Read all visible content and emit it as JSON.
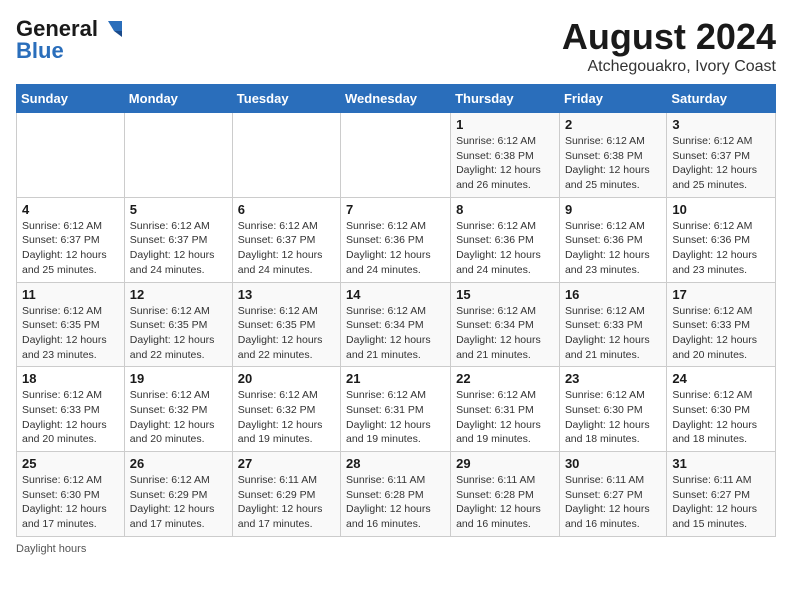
{
  "header": {
    "logo_general": "General",
    "logo_blue": "Blue",
    "month_title": "August 2024",
    "location": "Atchegouakro, Ivory Coast"
  },
  "days_of_week": [
    "Sunday",
    "Monday",
    "Tuesday",
    "Wednesday",
    "Thursday",
    "Friday",
    "Saturday"
  ],
  "weeks": [
    [
      {
        "day": "",
        "info": ""
      },
      {
        "day": "",
        "info": ""
      },
      {
        "day": "",
        "info": ""
      },
      {
        "day": "",
        "info": ""
      },
      {
        "day": "1",
        "info": "Sunrise: 6:12 AM\nSunset: 6:38 PM\nDaylight: 12 hours\nand 26 minutes."
      },
      {
        "day": "2",
        "info": "Sunrise: 6:12 AM\nSunset: 6:38 PM\nDaylight: 12 hours\nand 25 minutes."
      },
      {
        "day": "3",
        "info": "Sunrise: 6:12 AM\nSunset: 6:37 PM\nDaylight: 12 hours\nand 25 minutes."
      }
    ],
    [
      {
        "day": "4",
        "info": "Sunrise: 6:12 AM\nSunset: 6:37 PM\nDaylight: 12 hours\nand 25 minutes."
      },
      {
        "day": "5",
        "info": "Sunrise: 6:12 AM\nSunset: 6:37 PM\nDaylight: 12 hours\nand 24 minutes."
      },
      {
        "day": "6",
        "info": "Sunrise: 6:12 AM\nSunset: 6:37 PM\nDaylight: 12 hours\nand 24 minutes."
      },
      {
        "day": "7",
        "info": "Sunrise: 6:12 AM\nSunset: 6:36 PM\nDaylight: 12 hours\nand 24 minutes."
      },
      {
        "day": "8",
        "info": "Sunrise: 6:12 AM\nSunset: 6:36 PM\nDaylight: 12 hours\nand 24 minutes."
      },
      {
        "day": "9",
        "info": "Sunrise: 6:12 AM\nSunset: 6:36 PM\nDaylight: 12 hours\nand 23 minutes."
      },
      {
        "day": "10",
        "info": "Sunrise: 6:12 AM\nSunset: 6:36 PM\nDaylight: 12 hours\nand 23 minutes."
      }
    ],
    [
      {
        "day": "11",
        "info": "Sunrise: 6:12 AM\nSunset: 6:35 PM\nDaylight: 12 hours\nand 23 minutes."
      },
      {
        "day": "12",
        "info": "Sunrise: 6:12 AM\nSunset: 6:35 PM\nDaylight: 12 hours\nand 22 minutes."
      },
      {
        "day": "13",
        "info": "Sunrise: 6:12 AM\nSunset: 6:35 PM\nDaylight: 12 hours\nand 22 minutes."
      },
      {
        "day": "14",
        "info": "Sunrise: 6:12 AM\nSunset: 6:34 PM\nDaylight: 12 hours\nand 21 minutes."
      },
      {
        "day": "15",
        "info": "Sunrise: 6:12 AM\nSunset: 6:34 PM\nDaylight: 12 hours\nand 21 minutes."
      },
      {
        "day": "16",
        "info": "Sunrise: 6:12 AM\nSunset: 6:33 PM\nDaylight: 12 hours\nand 21 minutes."
      },
      {
        "day": "17",
        "info": "Sunrise: 6:12 AM\nSunset: 6:33 PM\nDaylight: 12 hours\nand 20 minutes."
      }
    ],
    [
      {
        "day": "18",
        "info": "Sunrise: 6:12 AM\nSunset: 6:33 PM\nDaylight: 12 hours\nand 20 minutes."
      },
      {
        "day": "19",
        "info": "Sunrise: 6:12 AM\nSunset: 6:32 PM\nDaylight: 12 hours\nand 20 minutes."
      },
      {
        "day": "20",
        "info": "Sunrise: 6:12 AM\nSunset: 6:32 PM\nDaylight: 12 hours\nand 19 minutes."
      },
      {
        "day": "21",
        "info": "Sunrise: 6:12 AM\nSunset: 6:31 PM\nDaylight: 12 hours\nand 19 minutes."
      },
      {
        "day": "22",
        "info": "Sunrise: 6:12 AM\nSunset: 6:31 PM\nDaylight: 12 hours\nand 19 minutes."
      },
      {
        "day": "23",
        "info": "Sunrise: 6:12 AM\nSunset: 6:30 PM\nDaylight: 12 hours\nand 18 minutes."
      },
      {
        "day": "24",
        "info": "Sunrise: 6:12 AM\nSunset: 6:30 PM\nDaylight: 12 hours\nand 18 minutes."
      }
    ],
    [
      {
        "day": "25",
        "info": "Sunrise: 6:12 AM\nSunset: 6:30 PM\nDaylight: 12 hours\nand 17 minutes."
      },
      {
        "day": "26",
        "info": "Sunrise: 6:12 AM\nSunset: 6:29 PM\nDaylight: 12 hours\nand 17 minutes."
      },
      {
        "day": "27",
        "info": "Sunrise: 6:11 AM\nSunset: 6:29 PM\nDaylight: 12 hours\nand 17 minutes."
      },
      {
        "day": "28",
        "info": "Sunrise: 6:11 AM\nSunset: 6:28 PM\nDaylight: 12 hours\nand 16 minutes."
      },
      {
        "day": "29",
        "info": "Sunrise: 6:11 AM\nSunset: 6:28 PM\nDaylight: 12 hours\nand 16 minutes."
      },
      {
        "day": "30",
        "info": "Sunrise: 6:11 AM\nSunset: 6:27 PM\nDaylight: 12 hours\nand 16 minutes."
      },
      {
        "day": "31",
        "info": "Sunrise: 6:11 AM\nSunset: 6:27 PM\nDaylight: 12 hours\nand 15 minutes."
      }
    ]
  ],
  "footer": {
    "note": "Daylight hours"
  }
}
